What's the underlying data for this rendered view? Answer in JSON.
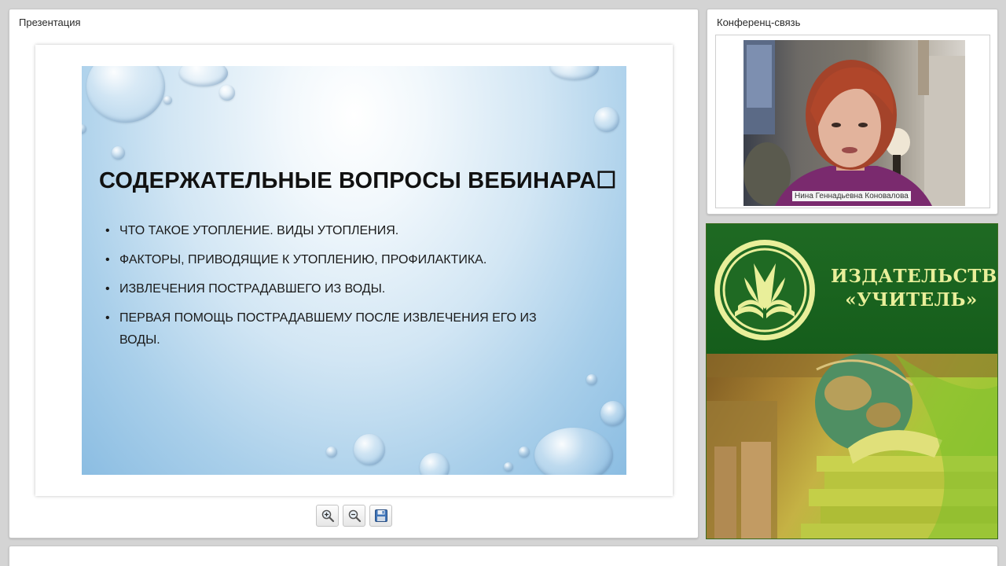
{
  "presentation": {
    "title": "Презентация",
    "slide": {
      "heading": "СОДЕРЖАТЕЛЬНЫЕ ВОПРОСЫ ВЕБИНАРА",
      "heading_glyph": "☐",
      "bullets": [
        "ЧТО ТАКОЕ УТОПЛЕНИЕ. ВИДЫ УТОПЛЕНИЯ.",
        "ФАКТОРЫ, ПРИВОДЯЩИЕ К УТОПЛЕНИЮ, ПРОФИЛАКТИКА.",
        "ИЗВЛЕЧЕНИЯ ПОСТРАДАВШЕГО ИЗ ВОДЫ.",
        "ПЕРВАЯ ПОМОЩЬ ПОСТРАДАВШЕМУ ПОСЛЕ ИЗВЛЕЧЕНИЯ ЕГО ИЗ ВОДЫ."
      ]
    },
    "toolbar": {
      "zoom_in_icon": "zoom-in-icon",
      "zoom_out_icon": "zoom-out-icon",
      "save_icon": "save-icon"
    }
  },
  "conference": {
    "title": "Конференц-связь",
    "participant_name": "Нина Геннадьевна Коновалова"
  },
  "ad": {
    "publisher_line1": "ИЗДАТЕЛЬСТВО",
    "publisher_line2": "«УЧИТЕЛЬ»",
    "colors": {
      "green": "#1f6a23",
      "text": "#e9ef9a"
    }
  }
}
